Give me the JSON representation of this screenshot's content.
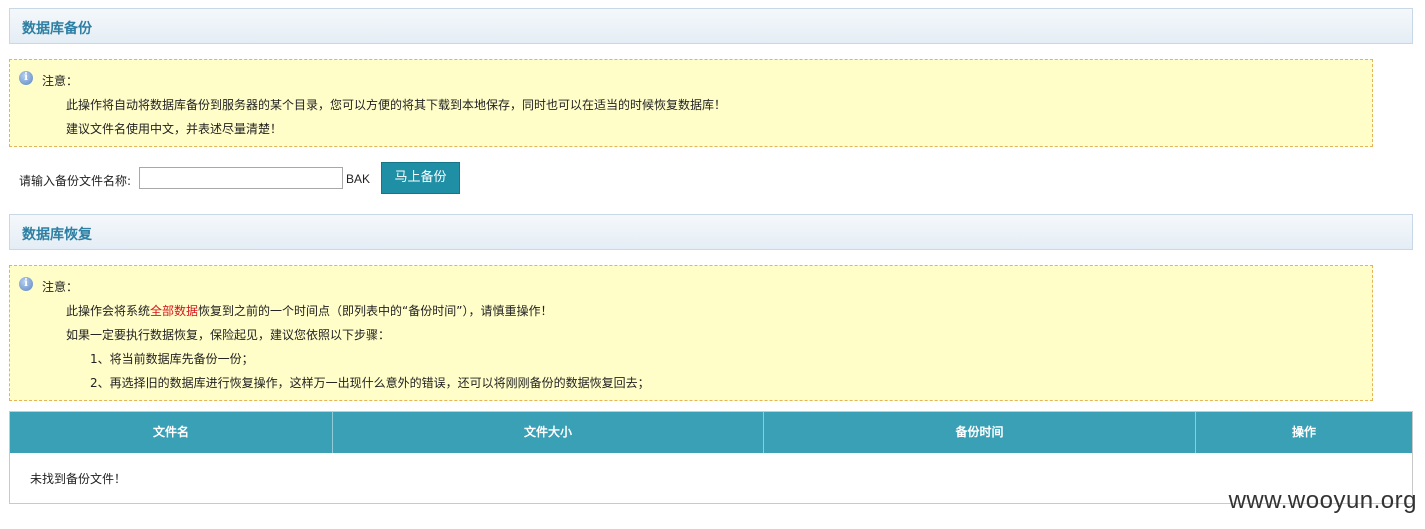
{
  "backup_section": {
    "title": "数据库备份",
    "notice": {
      "label": "注意：",
      "lines": [
        "此操作将自动将数据库备份到服务器的某个目录，您可以方便的将其下载到本地保存，同时也可以在适当的时候恢复数据库！",
        "建议文件名使用中文，并表述尽量清楚！"
      ]
    },
    "form": {
      "prompt": "请输入备份文件名称:",
      "input_value": "",
      "extension": "BAK",
      "button_label": "马上备份"
    }
  },
  "restore_section": {
    "title": "数据库恢复",
    "notice": {
      "label": "注意：",
      "line1_before": "此操作会将系统",
      "line1_highlight": "全部数据",
      "line1_after": "恢复到之前的一个时间点（即列表中的“备份时间”），请慎重操作！",
      "line2": "如果一定要执行数据恢复，保险起见，建议您依照以下步骤：",
      "step1": "1、将当前数据库先备份一份；",
      "step2": "2、再选择旧的数据库进行恢复操作，这样万一出现什么意外的错误，还可以将刚刚备份的数据恢复回去；",
      "highlight_color": "#d2141e"
    }
  },
  "table": {
    "columns": [
      "文件名",
      "文件大小",
      "备份时间",
      "操作"
    ],
    "empty_message": "未找到备份文件！"
  },
  "watermark": "www.wooyun.org",
  "colors": {
    "header_title": "#2d7fa3",
    "table_header_bg": "#3aa0b6",
    "button_bg": "#1f8fa6",
    "notice_bg": "#fffdc8",
    "notice_border": "#e5b35c"
  }
}
